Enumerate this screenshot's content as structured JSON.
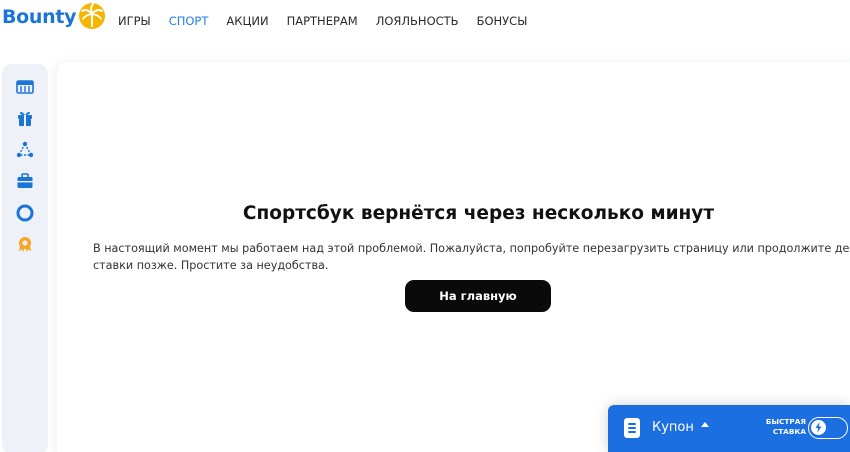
{
  "header": {
    "logo_text": "Bounty",
    "nav": [
      {
        "label": "ИГРЫ",
        "active": false
      },
      {
        "label": "СПОРТ",
        "active": true
      },
      {
        "label": "АКЦИИ",
        "active": false
      },
      {
        "label": "ПАРТНЕРАМ",
        "active": false
      },
      {
        "label": "ЛОЯЛЬНОСТЬ",
        "active": false
      },
      {
        "label": "БОНУСЫ",
        "active": false
      }
    ]
  },
  "sidebar": {
    "icons": [
      "scoreboard-icon",
      "gift-icon",
      "network-icon",
      "briefcase-icon",
      "lifebuoy-icon",
      "cog-medal-icon"
    ]
  },
  "main": {
    "title": "Спортсбук вернётся через несколько минут",
    "message": "В настоящий момент мы работаем над этой проблемой. Пожалуйста, попробуйте перезагрузить страницу или продолжите делать ставки позже. Простите за неудобства.",
    "home_button": "На главную"
  },
  "coupon": {
    "label": "Купон",
    "fast_bet_line1": "БЫСТРАЯ",
    "fast_bet_line2": "СТАВКА",
    "fast_bet_enabled": false
  },
  "colors": {
    "brand": "#1b74d8",
    "accent_sun": "#f5b400",
    "nav_active": "#1f7fe0",
    "coupon_bg": "#1c6fe0",
    "button_bg": "#0a0a0a"
  }
}
